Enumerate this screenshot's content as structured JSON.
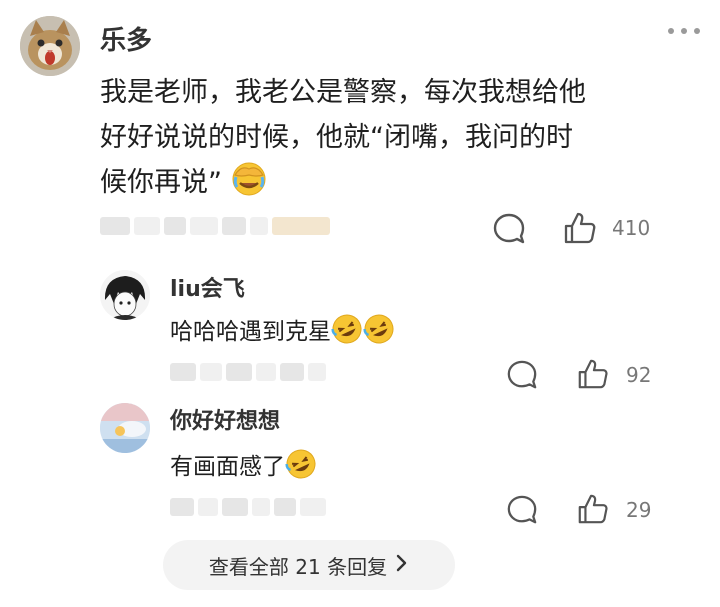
{
  "main_comment": {
    "author": "乐多",
    "lines": [
      "我是老师，我老公是警察，每次我想给他",
      "好好说说的时候，他就“闭嘴，我问的时",
      "候你再说”"
    ],
    "like_count": "410",
    "emoji": "facepalm-laughing-emoji"
  },
  "replies": [
    {
      "author": "liu会飞",
      "text": "哈哈哈遇到克星",
      "like_count": "92",
      "emoji": "rofl-emoji"
    },
    {
      "author": "你好好想想",
      "text": "有画面感了",
      "like_count": "29",
      "emoji": "rofl-emoji"
    }
  ],
  "view_replies": {
    "label": "查看全部 21 条回复"
  },
  "colors": {
    "emoji_yellow": "#f7c533",
    "icon_gray": "#555555",
    "pill_bg": "#f3f3f3"
  }
}
